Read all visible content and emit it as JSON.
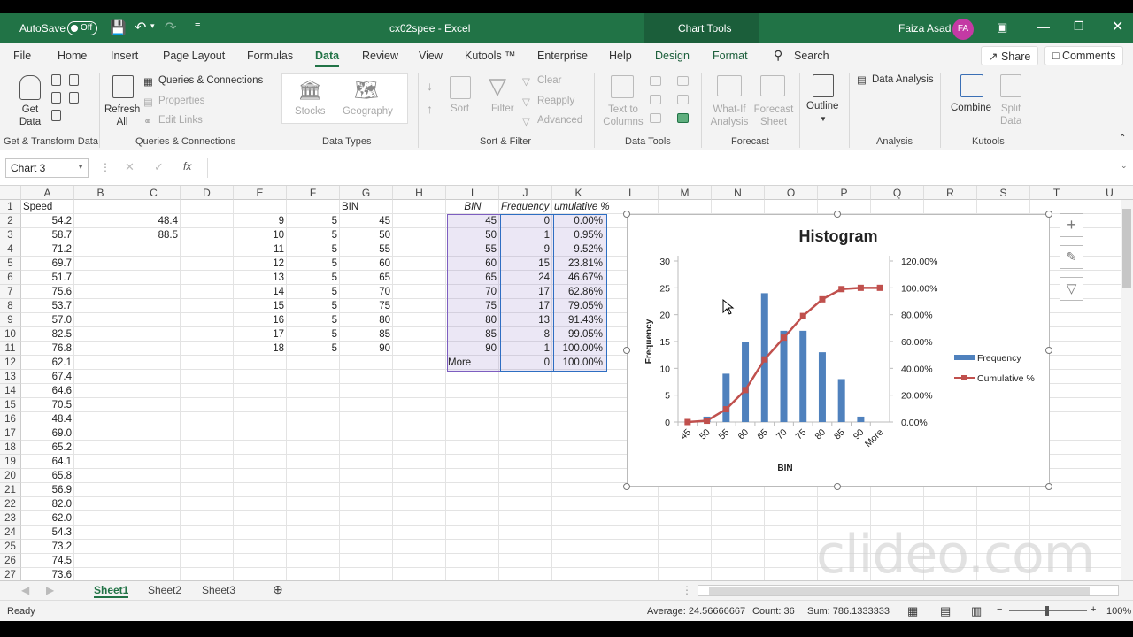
{
  "titlebar": {
    "autosave_label": "AutoSave",
    "autosave_state": "Off",
    "document_title": "cx02spee - Excel",
    "chart_tools": "Chart Tools",
    "user_name": "Faiza Asad",
    "user_initials": "FA"
  },
  "tabs": [
    "File",
    "Home",
    "Insert",
    "Page Layout",
    "Formulas",
    "Data",
    "Review",
    "View",
    "Kutools ™",
    "Enterprise",
    "Help",
    "Design",
    "Format"
  ],
  "active_tab": "Data",
  "search_label": "Search",
  "share_label": "Share",
  "comments_label": "Comments",
  "ribbon": {
    "get_data": "Get Data",
    "refresh_all": "Refresh All",
    "queries_connections": "Queries & Connections",
    "properties": "Properties",
    "edit_links": "Edit Links",
    "stocks": "Stocks",
    "geography": "Geography",
    "sort": "Sort",
    "filter": "Filter",
    "clear": "Clear",
    "reapply": "Reapply",
    "advanced": "Advanced",
    "text_to_columns": "Text to Columns",
    "what_if": "What-If Analysis",
    "forecast_sheet": "Forecast Sheet",
    "outline": "Outline",
    "data_analysis": "Data Analysis",
    "combine": "Combine",
    "split_data": "Split Data",
    "groups": {
      "g1": "Get & Transform Data",
      "g2": "Queries & Connections",
      "g3": "Data Types",
      "g4": "Sort & Filter",
      "g5": "Data Tools",
      "g6": "Forecast",
      "g7": "Analysis",
      "g8": "Kutools"
    }
  },
  "formula_bar": {
    "name_box": "Chart 3",
    "fx": "fx",
    "content": ""
  },
  "columns": [
    "A",
    "B",
    "C",
    "D",
    "E",
    "F",
    "G",
    "H",
    "I",
    "J",
    "K",
    "L",
    "M",
    "N",
    "O",
    "P",
    "Q",
    "R",
    "S",
    "T",
    "U"
  ],
  "rows": [
    "1",
    "2",
    "3",
    "4",
    "5",
    "6",
    "7",
    "8",
    "9",
    "10",
    "11",
    "12",
    "13",
    "14",
    "15",
    "16",
    "17",
    "18",
    "19",
    "20",
    "21",
    "22",
    "23",
    "24",
    "25",
    "26",
    "27"
  ],
  "cells": {
    "A": [
      "Speed",
      "54.2",
      "58.7",
      "71.2",
      "69.7",
      "51.7",
      "75.6",
      "53.7",
      "57.0",
      "82.5",
      "76.8",
      "62.1",
      "67.4",
      "64.6",
      "70.5",
      "48.4",
      "69.0",
      "65.2",
      "64.1",
      "65.8",
      "56.9",
      "82.0",
      "62.0",
      "54.3",
      "73.2",
      "74.5",
      "73.6"
    ],
    "C": [
      "",
      "48.4",
      "88.5"
    ],
    "E": [
      "",
      "9",
      "10",
      "11",
      "12",
      "13",
      "14",
      "15",
      "16",
      "17",
      "18"
    ],
    "F": [
      "",
      "5",
      "5",
      "5",
      "5",
      "5",
      "5",
      "5",
      "5",
      "5",
      "5"
    ],
    "G": [
      "BIN",
      "45",
      "50",
      "55",
      "60",
      "65",
      "70",
      "75",
      "80",
      "85",
      "90"
    ],
    "I": [
      "BIN",
      "45",
      "50",
      "55",
      "60",
      "65",
      "70",
      "75",
      "80",
      "85",
      "90",
      "More"
    ],
    "J": [
      "Frequency",
      "0",
      "1",
      "9",
      "15",
      "24",
      "17",
      "17",
      "13",
      "8",
      "1",
      "0"
    ],
    "K": [
      "umulative %",
      "0.00%",
      "0.95%",
      "9.52%",
      "23.81%",
      "46.67%",
      "62.86%",
      "79.05%",
      "91.43%",
      "99.05%",
      "100.00%",
      "100.00%"
    ]
  },
  "sheets": [
    "Sheet1",
    "Sheet2",
    "Sheet3"
  ],
  "active_sheet": "Sheet1",
  "status": {
    "ready": "Ready",
    "average": "Average: 24.56666667",
    "count": "Count: 36",
    "sum": "Sum: 786.1333333",
    "zoom": "100%"
  },
  "watermark": "clideo.com",
  "chart_data": {
    "type": "bar",
    "title": "Histogram",
    "xlabel": "BIN",
    "ylabel": "Frequency",
    "categories": [
      "45",
      "50",
      "55",
      "60",
      "65",
      "70",
      "75",
      "80",
      "85",
      "90",
      "More"
    ],
    "series": [
      {
        "name": "Frequency",
        "type": "bar",
        "axis": "left",
        "color": "#4f81bd",
        "values": [
          0,
          1,
          9,
          15,
          24,
          17,
          17,
          13,
          8,
          1,
          0
        ]
      },
      {
        "name": "Cumulative %",
        "type": "line",
        "axis": "right",
        "color": "#c0504d",
        "values": [
          0,
          0.95,
          9.52,
          23.81,
          46.67,
          62.86,
          79.05,
          91.43,
          99.05,
          100,
          100
        ]
      }
    ],
    "y_ticks": [
      "0",
      "5",
      "10",
      "15",
      "20",
      "25",
      "30"
    ],
    "ylim": [
      0,
      30
    ],
    "y2_ticks": [
      "0.00%",
      "20.00%",
      "40.00%",
      "60.00%",
      "80.00%",
      "100.00%",
      "120.00%"
    ],
    "y2lim": [
      0,
      120
    ],
    "legend": "right"
  }
}
